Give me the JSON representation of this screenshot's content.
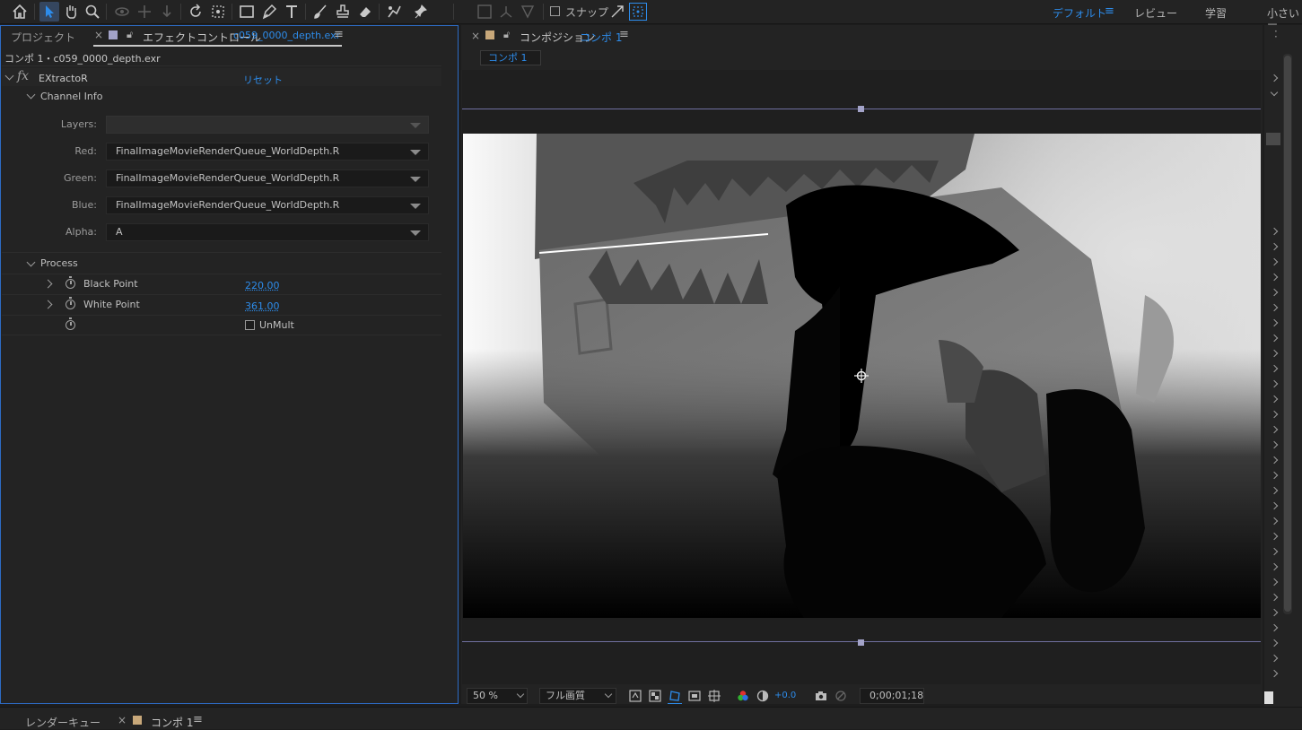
{
  "workspaces": {
    "default": "デフォルト",
    "review": "レビュー",
    "learn": "学習",
    "small": "小さい画"
  },
  "toolbar": {
    "snap_label": "スナップ"
  },
  "effect_panel": {
    "project_tab": "プロジェクト",
    "effect_tab": "エフェクトコントロール",
    "effect_tab_file": "c059_0000_depth.exr",
    "layer_path": "コンポ 1・c059_0000_depth.exr",
    "effect_name": "EXtractoR",
    "reset": "リセット",
    "channel_group": "Channel Info",
    "channels": [
      {
        "label": "Layers:",
        "value": "",
        "disabled": true
      },
      {
        "label": "Red:",
        "value": "FinalImageMovieRenderQueue_WorldDepth.R"
      },
      {
        "label": "Green:",
        "value": "FinalImageMovieRenderQueue_WorldDepth.R"
      },
      {
        "label": "Blue:",
        "value": "FinalImageMovieRenderQueue_WorldDepth.R"
      },
      {
        "label": "Alpha:",
        "value": "A"
      }
    ],
    "process_group": "Process",
    "black_point_label": "Black Point",
    "black_point_value": "220.00",
    "white_point_label": "White Point",
    "white_point_value": "361.00",
    "unmult_label": "UnMult"
  },
  "comp_panel": {
    "title": "コンポジション",
    "comp_name": "コンポ 1",
    "crumb": "コンポ 1",
    "zoom": "50 %",
    "quality": "フル画質",
    "exposure": "+0.0",
    "timecode": "0;00;01;18"
  },
  "bottom": {
    "render_queue": "レンダーキュー",
    "comp_tab": "コンポ 1"
  },
  "colors": {
    "accent": "#2d8ceb",
    "panel_bg": "#232323",
    "comp_label": "#c8a87a",
    "ec_label": "#a3a3c8"
  }
}
